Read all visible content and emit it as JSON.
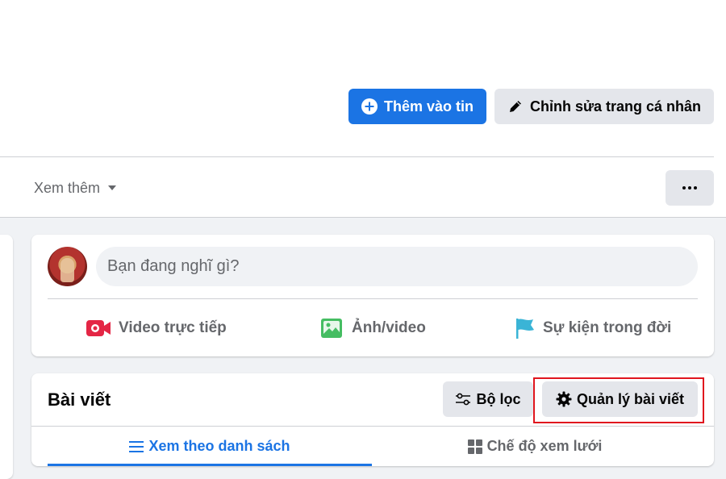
{
  "header": {
    "add_story_label": "Thêm vào tin",
    "edit_profile_label": "Chỉnh sửa trang cá nhân"
  },
  "nav": {
    "see_more_label": "Xem thêm"
  },
  "composer": {
    "placeholder": "Bạn đang nghĩ gì?",
    "actions": {
      "live_video": "Video trực tiếp",
      "photo_video": "Ảnh/video",
      "life_event": "Sự kiện trong đời"
    }
  },
  "posts": {
    "title": "Bài viết",
    "filter_label": "Bộ lọc",
    "manage_label": "Quản lý bài viết",
    "tabs": {
      "list_view": "Xem theo danh sách",
      "grid_view": "Chế độ xem lưới"
    }
  },
  "colors": {
    "primary": "#1b74e4",
    "secondary_bg": "#e4e6eb",
    "highlight": "#e0161e",
    "live_icon": "#e42645",
    "photo_icon": "#45bd62",
    "event_icon": "#3ab4d6"
  }
}
